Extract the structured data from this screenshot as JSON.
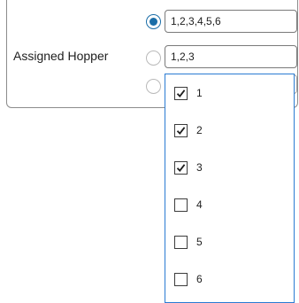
{
  "hopper": {
    "label": "Assigned Hopper",
    "radio_options": [
      {
        "selected": true,
        "value": "1,2,3,4,5,6"
      },
      {
        "selected": false,
        "value": "1,2,3"
      },
      {
        "selected": false,
        "value": ""
      }
    ],
    "dropdown_options": [
      {
        "label": "1",
        "checked": true
      },
      {
        "label": "2",
        "checked": true
      },
      {
        "label": "3",
        "checked": true
      },
      {
        "label": "4",
        "checked": false
      },
      {
        "label": "5",
        "checked": false
      },
      {
        "label": "6",
        "checked": false
      }
    ]
  },
  "colors": {
    "accent": "#1b6ea8",
    "dropdown_border": "#2a7bd3"
  }
}
